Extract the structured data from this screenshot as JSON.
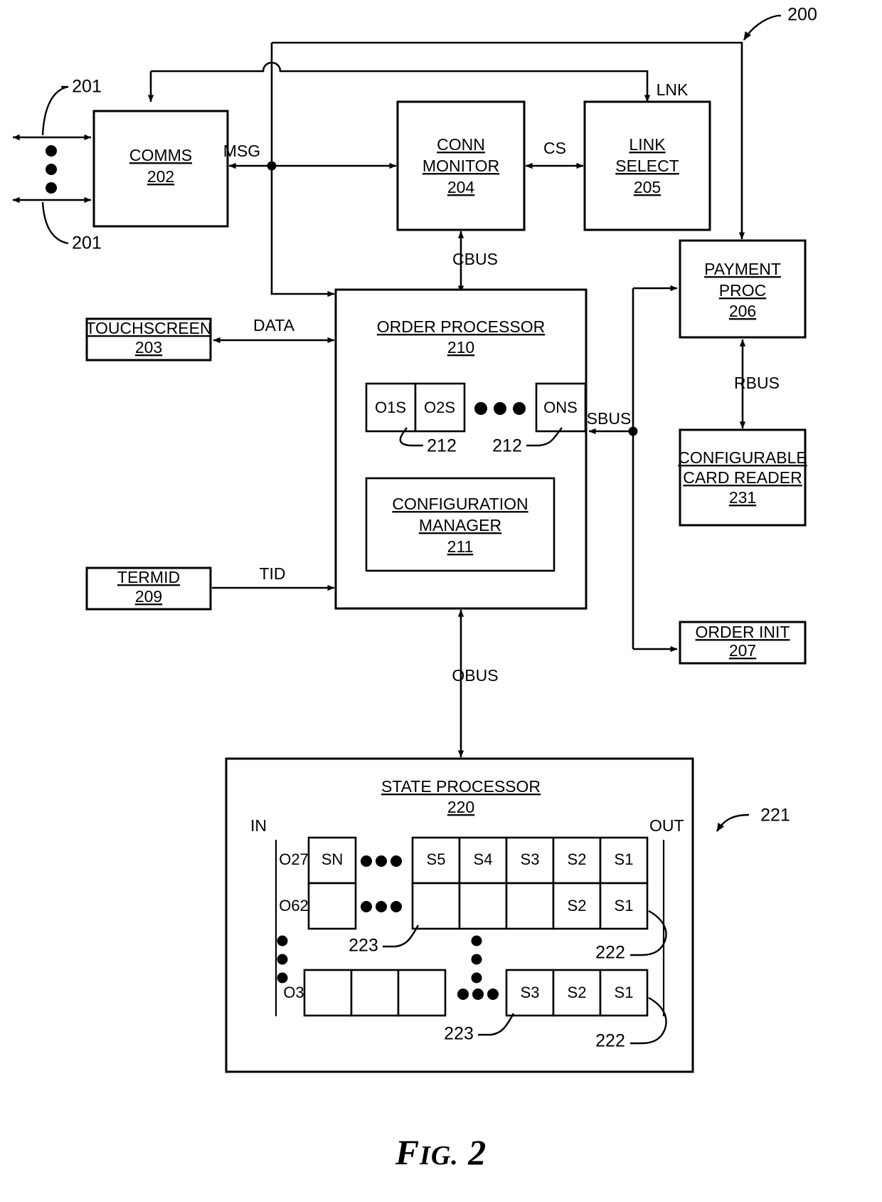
{
  "figure": {
    "caption_prefix": "F",
    "caption_small": "IG.",
    "caption_number": "2",
    "system_ref": "200"
  },
  "blocks": {
    "comms": {
      "title": "COMMS",
      "ref": "202"
    },
    "conn_monitor": {
      "title_line1": "CONN",
      "title_line2": "MONITOR",
      "ref": "204"
    },
    "link_select": {
      "title_line1": "LINK",
      "title_line2": "SELECT",
      "ref": "205"
    },
    "payment_proc": {
      "title_line1": "PAYMENT",
      "title_line2": "PROC",
      "ref": "206"
    },
    "card_reader": {
      "title_line1": "CONFIGURABLE",
      "title_line2": "CARD READER",
      "ref": "231"
    },
    "order_init": {
      "title": "ORDER INIT",
      "ref": "207"
    },
    "touchscreen": {
      "title": "TOUCHSCREEN",
      "ref": "203"
    },
    "termid": {
      "title": "TERMID",
      "ref": "209"
    },
    "order_processor": {
      "title": "ORDER  PROCESSOR",
      "ref": "210"
    },
    "config_manager": {
      "title_line1": "CONFIGURATION",
      "title_line2": "MANAGER",
      "ref": "211"
    },
    "state_processor": {
      "title": "STATE PROCESSOR",
      "ref": "220"
    }
  },
  "signals": {
    "msg": "MSG",
    "cs": "CS",
    "lnk": "LNK",
    "cbus": "CBUS",
    "data": "DATA",
    "tid": "TID",
    "sbus": "SBUS",
    "rbus": "RBUS",
    "obus": "OBUS"
  },
  "refs": {
    "comms_links_top": "201",
    "comms_links_bottom": "201",
    "order_state_left": "212",
    "order_state_right": "212",
    "state_queue": "221",
    "state_out_a": "222",
    "state_out_b": "222",
    "state_cell_a": "223",
    "state_cell_b": "223"
  },
  "order_states": {
    "cells": [
      "O1S",
      "O2S",
      "ONS"
    ],
    "ellipsis": "•••"
  },
  "state_processor": {
    "in_label": "IN",
    "out_label": "OUT",
    "rows": [
      {
        "order_id": "O27",
        "left_cell": "SN",
        "ellipsis": "•••",
        "right_cells": [
          "S5",
          "S4",
          "S3",
          "S2",
          "S1"
        ]
      },
      {
        "order_id": "O62",
        "left_cell": "",
        "ellipsis": "•••",
        "right_cells": [
          "",
          "",
          "",
          "S2",
          "S1"
        ]
      },
      {
        "order_id": "O3",
        "left_cells": [
          "",
          "",
          ""
        ],
        "ellipsis": "•••",
        "right_cells": [
          "S3",
          "S2",
          "S1"
        ]
      }
    ],
    "vertical_ellipsis": "•"
  },
  "colors": {
    "ink": "#000000",
    "paper": "#ffffff"
  }
}
